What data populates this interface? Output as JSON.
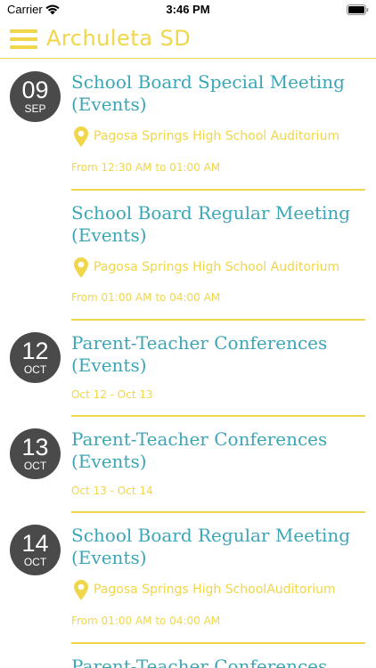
{
  "status": {
    "carrier": "Carrier",
    "time": "3:46 PM"
  },
  "header": {
    "title": "Archuleta SD"
  },
  "colors": {
    "accent": "#f0d64a",
    "title": "#3ba6b6",
    "badge": "#4a4a4a"
  },
  "events": [
    {
      "day": "09",
      "month": "SEP",
      "title_line1": "School Board Special Meeting",
      "title_line2": "(Events)",
      "location": "Pagosa Springs High School Auditorium",
      "time": "From 12:30 AM to 01:00 AM"
    },
    {
      "title_line1": "School Board Regular Meeting",
      "title_line2": "(Events)",
      "location": "Pagosa Springs High School Auditorium",
      "time": "From 01:00 AM to 04:00 AM"
    },
    {
      "day": "12",
      "month": "OCT",
      "title_line1": "Parent-Teacher Conferences",
      "title_line2": "(Events)",
      "time": "Oct 12 - Oct 13"
    },
    {
      "day": "13",
      "month": "OCT",
      "title_line1": "Parent-Teacher Conferences",
      "title_line2": "(Events)",
      "time": "Oct 13 - Oct 14"
    },
    {
      "day": "14",
      "month": "OCT",
      "title_line1": "School Board Regular Meeting",
      "title_line2": "(Events)",
      "location": "Pagosa Springs High SchoolAuditorium",
      "time": "From 01:00 AM to 04:00 AM"
    },
    {
      "title_line1": "Parent-Teacher Conferences"
    }
  ]
}
